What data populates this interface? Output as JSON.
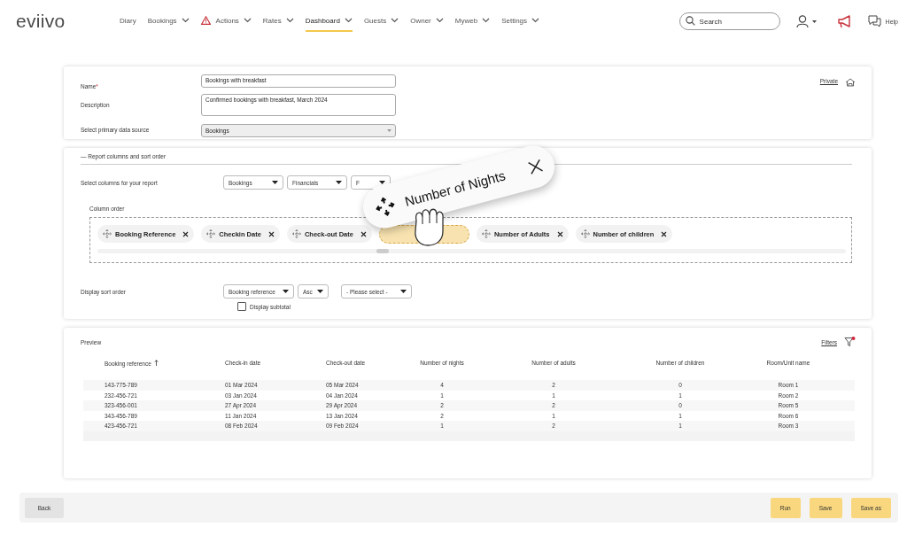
{
  "header": {
    "logo": "eviivo",
    "nav": [
      {
        "label": "Diary",
        "dropdown": false,
        "alert": false,
        "selected": false
      },
      {
        "label": "Bookings",
        "dropdown": true,
        "alert": false,
        "selected": false
      },
      {
        "label": "Actions",
        "dropdown": true,
        "alert": true,
        "selected": false
      },
      {
        "label": "Rates",
        "dropdown": true,
        "alert": false,
        "selected": false
      },
      {
        "label": "Dashboard",
        "dropdown": true,
        "alert": false,
        "selected": true
      },
      {
        "label": "Guests",
        "dropdown": true,
        "alert": false,
        "selected": false
      },
      {
        "label": "Owner",
        "dropdown": true,
        "alert": false,
        "selected": false
      },
      {
        "label": "Myweb",
        "dropdown": true,
        "alert": false,
        "selected": false
      },
      {
        "label": "Settings",
        "dropdown": true,
        "alert": false,
        "selected": false
      }
    ],
    "search": {
      "placeholder": "Search"
    },
    "help": "Help"
  },
  "details": {
    "name_label": "Name",
    "required_mark": "*",
    "name_value": "Bookings with breakfast",
    "description_label": "Description",
    "description_value": "Confirmed bookings with breakfast, March 2024",
    "source_label": "Select primary data source",
    "source_value": "Bookings",
    "visibility_link": "Private"
  },
  "columns_section": {
    "title": "— Report columns and sort order",
    "select_label": "Select columns for your report",
    "selects": [
      "Bookings",
      "Financials",
      "F"
    ],
    "order_label": "Column order",
    "chips": [
      {
        "kind": "chip",
        "label": "Booking Reference"
      },
      {
        "kind": "chip",
        "label": "Checkin Date"
      },
      {
        "kind": "chip",
        "label": "Check-out Date"
      },
      {
        "kind": "slot"
      },
      {
        "kind": "chip",
        "label": "Number of Adults"
      },
      {
        "kind": "chip",
        "label": "Number of children"
      }
    ],
    "dragged_chip": {
      "label": "Number of Nights"
    },
    "sort_label": "Display sort order",
    "sort_field": "Booking reference",
    "sort_direction": "Asc",
    "sort_second": "- Please select -",
    "subtotal": {
      "label": "Display subtotal",
      "checked": false
    }
  },
  "preview": {
    "title": "Preview",
    "filters_link": "Filters",
    "filters_active": true,
    "columns": [
      {
        "label": "Booking reference",
        "sorted": true
      },
      {
        "label": "Check-in date",
        "sorted": false
      },
      {
        "label": "Check-out date",
        "sorted": false
      },
      {
        "label": "Number of nights",
        "sorted": false
      },
      {
        "label": "Number of adults",
        "sorted": false
      },
      {
        "label": "Number of children",
        "sorted": false
      },
      {
        "label": "Room/Unit name",
        "sorted": false
      }
    ],
    "rows": [
      [
        "143-775-789",
        "01 Mar 2024",
        "05 Mar 2024",
        "4",
        "2",
        "0",
        "Room 1"
      ],
      [
        "232-456-721",
        "03 Jan 2024",
        "04 Jan 2024",
        "1",
        "1",
        "1",
        "Room 2"
      ],
      [
        "323-456-001",
        "27 Apr 2024",
        "29 Apr 2024",
        "2",
        "2",
        "0",
        "Room 5"
      ],
      [
        "343-456-789",
        "11 Jan 2024",
        "13 Jan 2024",
        "2",
        "1",
        "1",
        "Room 6"
      ],
      [
        "423-456-721",
        "08 Feb 2024",
        "09 Feb 2024",
        "1",
        "2",
        "1",
        "Room 3"
      ]
    ]
  },
  "footer": {
    "back": "Back",
    "actions": [
      "Run",
      "Save",
      "Save as"
    ]
  }
}
